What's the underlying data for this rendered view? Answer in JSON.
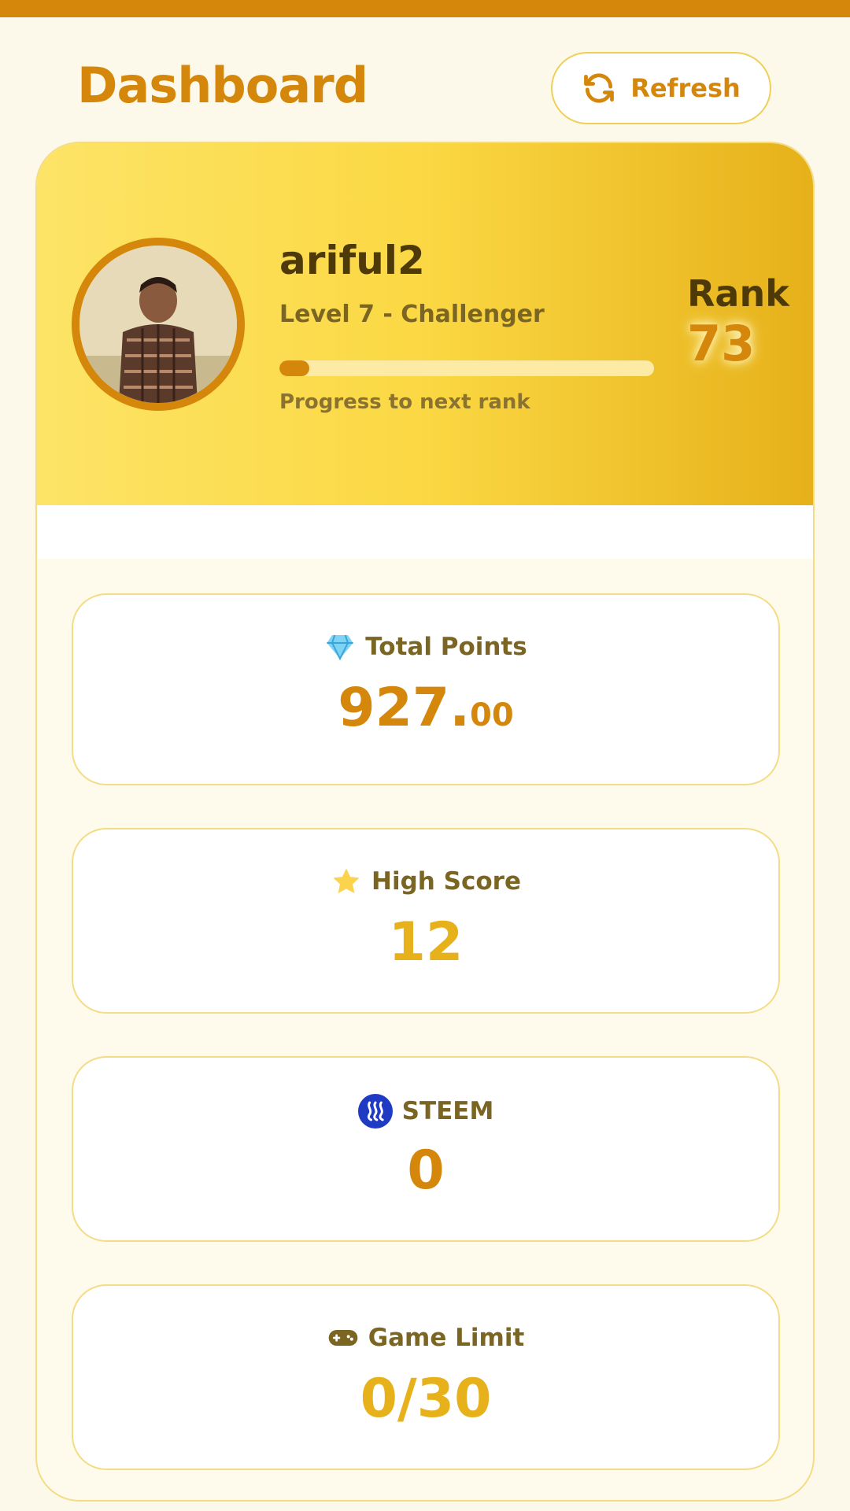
{
  "header": {
    "title": "Dashboard",
    "refresh_label": "Refresh",
    "refresh_icon": "refresh-icon"
  },
  "profile": {
    "username": "ariful2",
    "level_text": "Level 7 - Challenger",
    "progress_label": "Progress to next rank",
    "progress_fraction": 0.08,
    "rank_label": "Rank",
    "rank_value": "73"
  },
  "stats": {
    "total_points": {
      "label": "Total Points",
      "icon": "gem-icon",
      "value_main": "927.",
      "value_decimals": "00",
      "color": "#d4870a"
    },
    "high_score": {
      "label": "High Score",
      "icon": "star-icon",
      "value": "12",
      "color": "#e6b11a"
    },
    "steem": {
      "label": "STEEM",
      "icon": "steem-icon",
      "value": "0",
      "color": "#d4870a"
    },
    "game_limit": {
      "label": "Game Limit",
      "icon": "gamepad-icon",
      "value": "0/30",
      "color": "#e6b11a"
    }
  },
  "colors": {
    "accent": "#d4870a",
    "accent_light": "#e6b11a",
    "background": "#fdf9ea",
    "card_border": "#f4dc86"
  }
}
